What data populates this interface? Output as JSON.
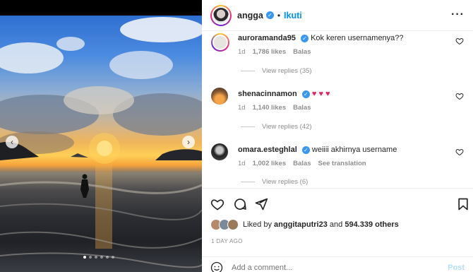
{
  "post": {
    "photo_alt": "sunset-beach-photo",
    "carousel_dots": 6,
    "active_dot": 0
  },
  "header": {
    "username": "angga",
    "separator": "•",
    "follow_label": "Ikuti",
    "more_label": "···"
  },
  "comments": [
    {
      "username": "auroramanda95",
      "text": "Kok keren usernamenya??",
      "time": "1d",
      "likes": "1,786 likes",
      "reply_label": "Balas",
      "view_replies": "View replies (35)"
    },
    {
      "username": "shenacinnamon",
      "text": "",
      "hearts": "♥ ♥ ♥",
      "time": "1d",
      "likes": "1,140 likes",
      "reply_label": "Balas",
      "view_replies": "View replies (42)"
    },
    {
      "username": "omara.esteghlal",
      "text": "weiiii akhirnya username",
      "time": "1d",
      "likes": "1,002 likes",
      "reply_label": "Balas",
      "translate_label": "See translation",
      "view_replies": "View replies (6)"
    }
  ],
  "likes": {
    "prefix": "Liked by",
    "user": "anggitaputri23",
    "connector": "and",
    "others": "594.339 others"
  },
  "timestamp": "1 DAY AGO",
  "add_comment": {
    "placeholder": "Add a comment...",
    "post_label": "Post"
  },
  "colors": {
    "accent": "#0095f6",
    "verified": "#3897f0",
    "heart": "#e0245e"
  }
}
